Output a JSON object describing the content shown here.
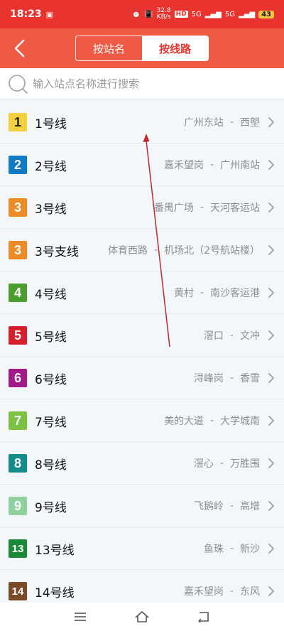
{
  "status_bar": {
    "time": "18:23",
    "net_speed_top": "32.8",
    "net_speed_bottom": "KB/s",
    "hd_label": "HD",
    "sim1": "5G",
    "sim2": "5G",
    "battery": "43"
  },
  "header": {
    "tab_station": "按站名",
    "tab_line": "按线路",
    "active_tab": "tab_line"
  },
  "search": {
    "placeholder": "输入站点名称进行搜索"
  },
  "lines": [
    {
      "number": "1",
      "name": "1号线",
      "from": "广州东站",
      "to": "西塱",
      "color": "#f3d03e",
      "dark": true
    },
    {
      "number": "2",
      "name": "2号线",
      "from": "嘉禾望岗",
      "to": "广州南站",
      "color": "#0f7bc4",
      "dark": false
    },
    {
      "number": "3",
      "name": "3号线",
      "from": "番禺广场",
      "to": "天河客运站",
      "color": "#ec8b27",
      "dark": false
    },
    {
      "number": "3",
      "name": "3号支线",
      "from": "体育西路",
      "to": "机场北（2号航站楼）",
      "color": "#ec8b27",
      "dark": false
    },
    {
      "number": "4",
      "name": "4号线",
      "from": "黄村",
      "to": "南沙客运港",
      "color": "#4c9d2f",
      "dark": false
    },
    {
      "number": "5",
      "name": "5号线",
      "from": "滘口",
      "to": "文冲",
      "color": "#d71f2e",
      "dark": false
    },
    {
      "number": "6",
      "name": "6号线",
      "from": "浔峰岗",
      "to": "香雪",
      "color": "#a3198a",
      "dark": false
    },
    {
      "number": "7",
      "name": "7号线",
      "from": "美的大道",
      "to": "大学城南",
      "color": "#7bc143",
      "dark": false
    },
    {
      "number": "8",
      "name": "8号线",
      "from": "滘心",
      "to": "万胜围",
      "color": "#148d8a",
      "dark": false
    },
    {
      "number": "9",
      "name": "9号线",
      "from": "飞鹅岭",
      "to": "高增",
      "color": "#8fd19e",
      "dark": false
    },
    {
      "number": "13",
      "name": "13号线",
      "from": "鱼珠",
      "to": "新沙",
      "color": "#1a8a3a",
      "dark": false
    },
    {
      "number": "14",
      "name": "14号线",
      "from": "嘉禾望岗",
      "to": "东风",
      "color": "#7a4a28",
      "dark": false
    }
  ],
  "route_separator": "-",
  "icons": {
    "back": "back-arrow-icon",
    "search": "search-icon",
    "chevron": "chevron-right-icon",
    "nav_menu": "menu-icon",
    "nav_home": "home-icon",
    "nav_back": "return-icon"
  },
  "colors": {
    "status_bar": "#e8332e",
    "header": "#ef5a44",
    "annotation_arrow": "#c0282d"
  }
}
